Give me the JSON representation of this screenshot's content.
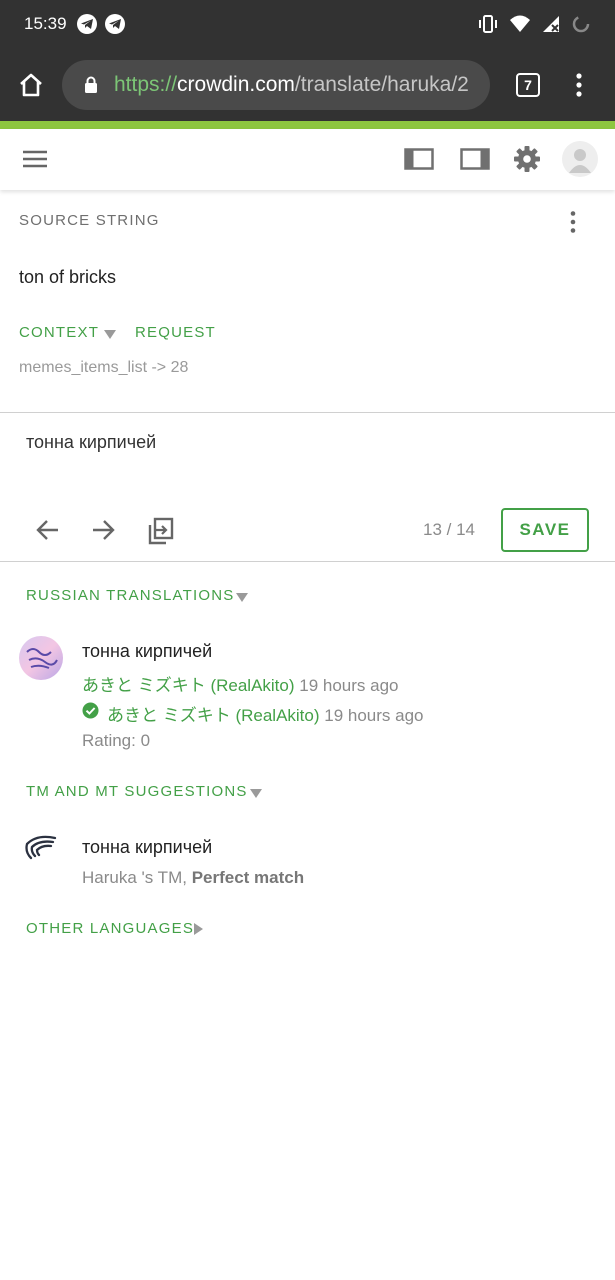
{
  "status_bar": {
    "time": "15:39",
    "icons": [
      "telegram-icon",
      "telegram-icon",
      "vibrate-icon",
      "wifi-icon",
      "signal-icon",
      "loading-icon"
    ]
  },
  "browser": {
    "url_scheme": "https://",
    "url_host": "crowdin.com",
    "url_path": "/translate/haruka/2",
    "tab_count": "7"
  },
  "colors": {
    "accent": "#43a047",
    "brand_line": "#8dc63f",
    "chrome": "#323232"
  },
  "source": {
    "label": "SOURCE STRING",
    "text": "ton of bricks",
    "context_label": "CONTEXT",
    "request_label": "REQUEST",
    "context_value": "memes_items_list -> 28"
  },
  "editor": {
    "translation": "тонна кирпичей",
    "counter": "13 / 14",
    "save_label": "SAVE"
  },
  "russian_translations": {
    "title": "RUSSIAN TRANSLATIONS",
    "items": [
      {
        "text": "тонна кирпичей",
        "author": "あきと ミズキト (RealAkito)",
        "author_time": "19 hours ago",
        "approver": "あきと ミズキト (RealAkito)",
        "approver_time": "19 hours ago",
        "rating": "Rating: 0"
      }
    ]
  },
  "tm_suggestions": {
    "title": "TM AND MT SUGGESTIONS",
    "items": [
      {
        "text": "тонна кирпичей",
        "source": "Haruka 's TM, ",
        "match": "Perfect match"
      }
    ]
  },
  "other_languages": {
    "title": "OTHER LANGUAGES"
  }
}
